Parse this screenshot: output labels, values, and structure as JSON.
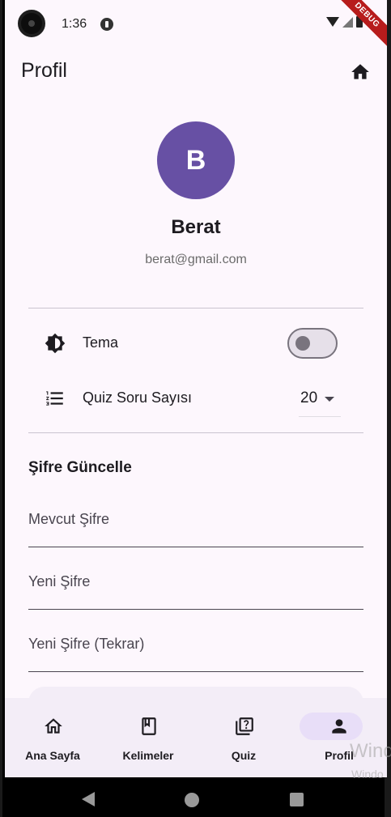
{
  "status_bar": {
    "time": "1:36",
    "debug_label": "DEBUG"
  },
  "app_bar": {
    "title": "Profil",
    "action_icon": "home-icon"
  },
  "profile": {
    "avatar_initial": "B",
    "name": "Berat",
    "email": "berat@gmail.com",
    "avatar_color": "#6750a4"
  },
  "settings": {
    "theme": {
      "label": "Tema",
      "icon": "brightness-icon",
      "enabled": false
    },
    "quiz_count": {
      "label": "Quiz Soru Sayısı",
      "icon": "list-icon",
      "value": "20"
    }
  },
  "password": {
    "title": "Şifre Güncelle",
    "current_placeholder": "Mevcut Şifre",
    "new_placeholder": "Yeni Şifre",
    "repeat_placeholder": "Yeni Şifre (Tekrar)"
  },
  "bottom_nav": {
    "items": [
      {
        "label": "Ana Sayfa",
        "icon": "home-outline-icon",
        "active": false
      },
      {
        "label": "Kelimeler",
        "icon": "bookmark-book-icon",
        "active": false
      },
      {
        "label": "Quiz",
        "icon": "quiz-icon",
        "active": false
      },
      {
        "label": "Profil",
        "icon": "person-icon",
        "active": true
      }
    ]
  },
  "watermark": {
    "line1": "Wind",
    "line2": "Windo"
  }
}
